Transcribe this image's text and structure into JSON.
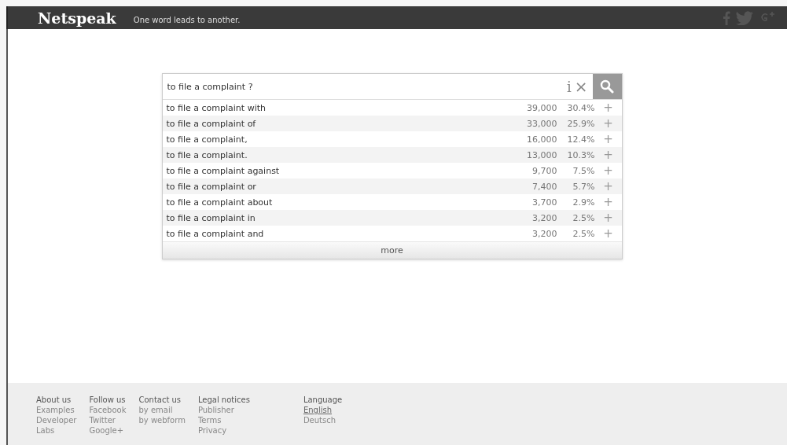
{
  "header": {
    "logo": "Netspeak",
    "tagline": "One word leads to another."
  },
  "search": {
    "value": "to file a complaint ?",
    "info": "i",
    "clear": "×"
  },
  "results": [
    {
      "phrase": "to file a complaint with",
      "count": "39,000",
      "share": "30.4%",
      "add": "+"
    },
    {
      "phrase": "to file a complaint of",
      "count": "33,000",
      "share": "25.9%",
      "add": "+"
    },
    {
      "phrase": "to file a complaint,",
      "count": "16,000",
      "share": "12.4%",
      "add": "+"
    },
    {
      "phrase": "to file a complaint.",
      "count": "13,000",
      "share": "10.3%",
      "add": "+"
    },
    {
      "phrase": "to file a complaint against",
      "count": "9,700",
      "share": "7.5%",
      "add": "+"
    },
    {
      "phrase": "to file a complaint or",
      "count": "7,400",
      "share": "5.7%",
      "add": "+"
    },
    {
      "phrase": "to file a complaint about",
      "count": "3,700",
      "share": "2.9%",
      "add": "+"
    },
    {
      "phrase": "to file a complaint in",
      "count": "3,200",
      "share": "2.5%",
      "add": "+"
    },
    {
      "phrase": "to file a complaint and",
      "count": "3,200",
      "share": "2.5%",
      "add": "+"
    }
  ],
  "more": "more",
  "footer": {
    "columns": [
      {
        "heading": "About us",
        "links": [
          {
            "label": "Examples"
          },
          {
            "label": "Developer"
          },
          {
            "label": "Labs"
          }
        ]
      },
      {
        "heading": "Follow us",
        "links": [
          {
            "label": "Facebook"
          },
          {
            "label": "Twitter"
          },
          {
            "label": "Google+"
          }
        ]
      },
      {
        "heading": "Contact us",
        "links": [
          {
            "label": "by email"
          },
          {
            "label": "by webform"
          }
        ]
      },
      {
        "heading": "Legal notices",
        "links": [
          {
            "label": "Publisher"
          },
          {
            "label": "Terms"
          },
          {
            "label": "Privacy"
          }
        ]
      },
      {
        "heading": "Language",
        "links": [
          {
            "label": "English",
            "selected": true
          },
          {
            "label": "Deutsch",
            "selected": false
          }
        ]
      }
    ]
  }
}
